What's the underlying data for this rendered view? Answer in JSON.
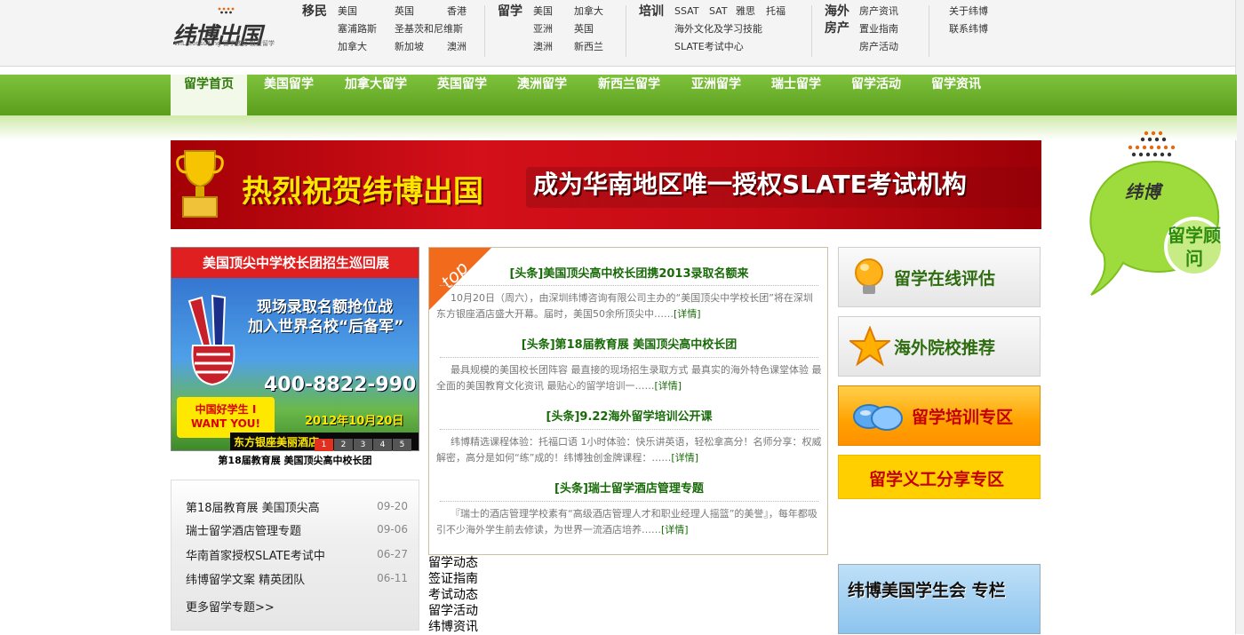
{
  "header": {
    "logo_text": "纬博出国",
    "logo_sub": "WIL-Consulting",
    "logo_tag": "留学移民·投资留学",
    "groups": [
      {
        "title": "移民",
        "links": [
          "美国",
          "英国",
          "香港",
          "塞浦路斯",
          "圣基茨和尼维斯",
          "加拿大",
          "新加坡",
          "澳洲"
        ]
      },
      {
        "title": "留学",
        "links": [
          "美国",
          "加拿大",
          "亚洲",
          "英国",
          "澳洲",
          "新西兰"
        ]
      },
      {
        "title": "培训",
        "links": [
          "SSAT",
          "SAT",
          "雅思",
          "托福",
          "海外文化及学习技能",
          "SLATE考试中心"
        ]
      },
      {
        "title": "海外房产",
        "links": [
          "房产资讯",
          "置业指南",
          "房产活动"
        ]
      },
      {
        "title": "",
        "links": [
          "关于纬博",
          "联系纬博"
        ]
      }
    ]
  },
  "menu": [
    "留学首页",
    "美国留学",
    "加拿大留学",
    "英国留学",
    "澳洲留学",
    "新西兰留学",
    "亚洲留学",
    "瑞士留学",
    "留学活动",
    "留学资讯"
  ],
  "banner": {
    "text1": "热烈祝贺纬博出国",
    "text2": "成为华南地区唯一授权SLATE考试机构"
  },
  "promo": {
    "title": "美国顶尖中学校长团招生巡回展",
    "sub1": "现场录取名额抢位战",
    "sub2": "加入世界名校“后备军”",
    "phone": "400-8822-990",
    "kid": "中国好学生 I WANT YOU!",
    "date": "2012年10月20日",
    "venue": "东方银座美丽酒店",
    "slides": [
      "1",
      "2",
      "3",
      "4",
      "5"
    ],
    "caption": "第18届教育展 美国顶尖高中校长团"
  },
  "news": {
    "items": [
      {
        "title": "第18届教育展 美国顶尖高",
        "date": "09-20"
      },
      {
        "title": "瑞士留学酒店管理专题",
        "date": "09-06"
      },
      {
        "title": "华南首家授权SLATE考试中",
        "date": "06-27"
      },
      {
        "title": "纬博留学文案 精英团队",
        "date": "06-11"
      }
    ],
    "more": "更多留学专题>>"
  },
  "heads": {
    "ribbon": "top",
    "items": [
      {
        "title": "[头条]美国顶尖高中校长团携2013录取名额来",
        "body": "10月20日（周六），由深圳纬博咨询有限公司主办的“美国顶尖中学校长团”将在深圳东方银座酒店盛大开幕。届时，美国50余所顶尖中……",
        "more": "[详情]"
      },
      {
        "title": "[头条]第18届教育展 美国顶尖高中校长团",
        "body": "最具规模的美国校长团阵容 最直接的现场招生录取方式 最真实的海外特色课堂体验 最全面的美国教育文化资讯 最贴心的留学培训一……",
        "more": "[详情]"
      },
      {
        "title": "[头条]9.22海外留学培训公开课",
        "body": "纬博精选课程体验：托福口语 1小时体验：快乐讲英语，轻松拿高分！名师分享：权威解密，高分是如何“练”成的！纬博独创金牌课程：……",
        "more": "[详情]"
      },
      {
        "title": "[头条]瑞士留学酒店管理专题",
        "body": "『瑞士的酒店管理学校素有“高级酒店管理人才和职业经理人摇篮”的美誉』，每年都吸引不少海外学生前去修读，为世界一流酒店培养……",
        "more": "[详情]"
      }
    ]
  },
  "plain_list": [
    "留学动态",
    "签证指南",
    "考试动态",
    "留学活动",
    "纬博资讯"
  ],
  "right": {
    "boxes": [
      "留学在线评估",
      "海外院校推荐",
      "留学培训专区",
      "留学义工分享专区"
    ],
    "union": "纬博美国学生会 专栏"
  },
  "bubble": {
    "logo": "纬博",
    "label": "留学顾问"
  },
  "colors": {
    "menu_green": "#5a9e1d",
    "head_green": "#176a07",
    "banner_red": "#d4101a"
  }
}
